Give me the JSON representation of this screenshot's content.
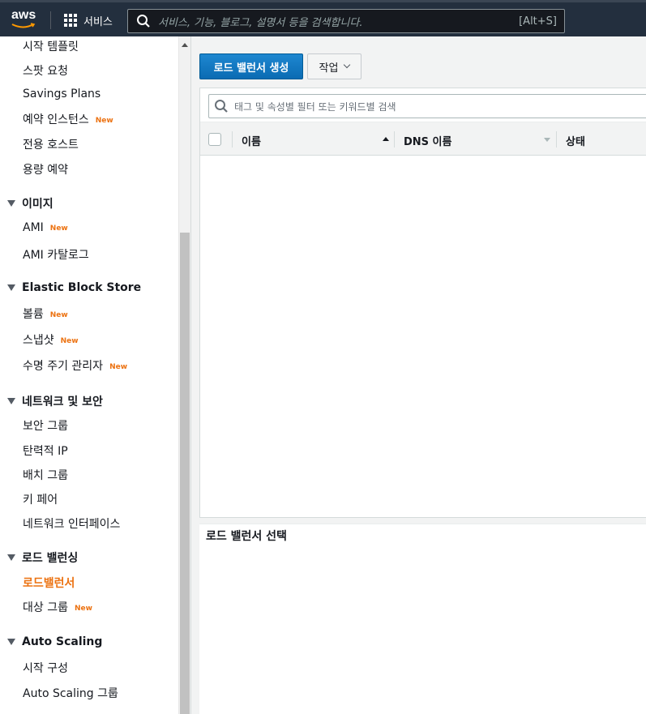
{
  "topbar": {
    "logo_text": "aws",
    "services_label": "서비스",
    "search_placeholder": "서비스, 기능, 블로그, 설명서 등을 검색합니다.",
    "search_shortcut": "[Alt+S]"
  },
  "sidebar": {
    "items_top": [
      {
        "label": "시작 템플릿"
      },
      {
        "label": "스팟 요청"
      },
      {
        "label": "Savings Plans"
      },
      {
        "label": "예약 인스턴스",
        "badge": "New"
      },
      {
        "label": "전용 호스트"
      },
      {
        "label": "용량 예약"
      }
    ],
    "sections": [
      {
        "title": "이미지",
        "items": [
          {
            "label": "AMI",
            "badge": "New"
          },
          {
            "label": "AMI 카탈로그"
          }
        ]
      },
      {
        "title": "Elastic Block Store",
        "items": [
          {
            "label": "볼륨",
            "badge": "New"
          },
          {
            "label": "스냅샷",
            "badge": "New"
          },
          {
            "label": "수명 주기 관리자",
            "badge": "New"
          }
        ]
      },
      {
        "title": "네트워크 및 보안",
        "items": [
          {
            "label": "보안 그룹"
          },
          {
            "label": "탄력적 IP"
          },
          {
            "label": "배치 그룹"
          },
          {
            "label": "키 페어"
          },
          {
            "label": "네트워크 인터페이스"
          }
        ]
      },
      {
        "title": "로드 밸런싱",
        "items": [
          {
            "label": "로드밸런서",
            "active": true
          },
          {
            "label": "대상 그룹",
            "badge": "New"
          }
        ]
      },
      {
        "title": "Auto Scaling",
        "items": [
          {
            "label": "시작 구성"
          },
          {
            "label": "Auto Scaling 그룹"
          }
        ]
      }
    ]
  },
  "main": {
    "create_button": "로드 밸런서 생성",
    "actions_button": "작업",
    "filter_placeholder": "태그 및 속성별 필터 또는 키워드별 검색",
    "columns": [
      "이름",
      "DNS 이름",
      "상태"
    ],
    "detail_title": "로드 밸런서 선택"
  },
  "colors": {
    "nav_bg": "#232f3e",
    "primary": "#0073bb",
    "accent_orange": "#ec7211"
  }
}
